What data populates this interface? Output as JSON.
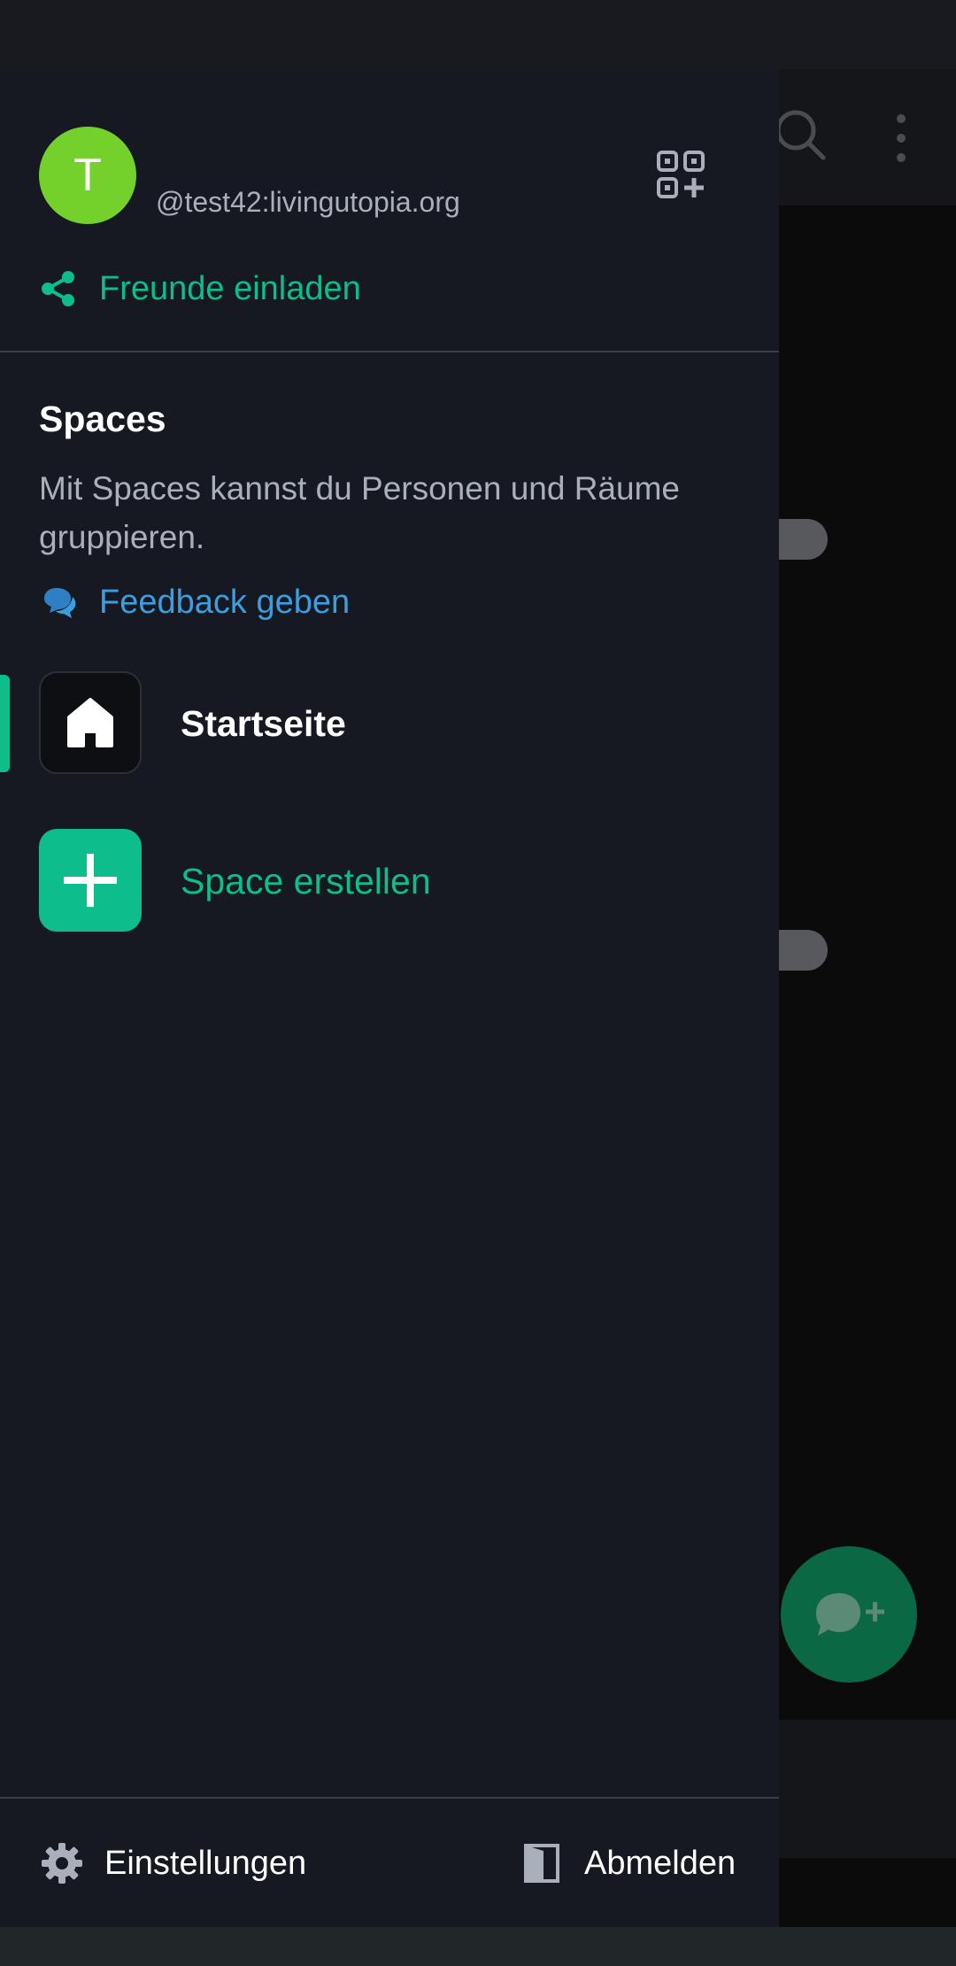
{
  "drawer": {
    "avatar_initial": "T",
    "user_id": "@test42:livingutopia.org",
    "invite_label": "Freunde einladen",
    "spaces": {
      "title": "Spaces",
      "description": "Mit Spaces kannst du Personen und Räume gruppieren.",
      "feedback_label": "Feedback geben",
      "items": [
        {
          "label": "Startseite",
          "icon": "home-icon",
          "active": true
        },
        {
          "label": "Space erstellen",
          "icon": "plus-icon",
          "active": false
        }
      ]
    },
    "footer": {
      "settings_label": "Einstellungen",
      "logout_label": "Abmelden"
    }
  },
  "colors": {
    "accent": "#0dbd8b",
    "link": "#3a9ee0",
    "avatar": "#74d12c",
    "drawer_bg": "#161921"
  },
  "icons": [
    "qr-code-add-icon",
    "share-icon",
    "feedback-icon",
    "home-icon",
    "plus-icon",
    "gear-icon",
    "logout-door-icon",
    "search-icon",
    "more-vert-icon",
    "new-chat-icon"
  ]
}
